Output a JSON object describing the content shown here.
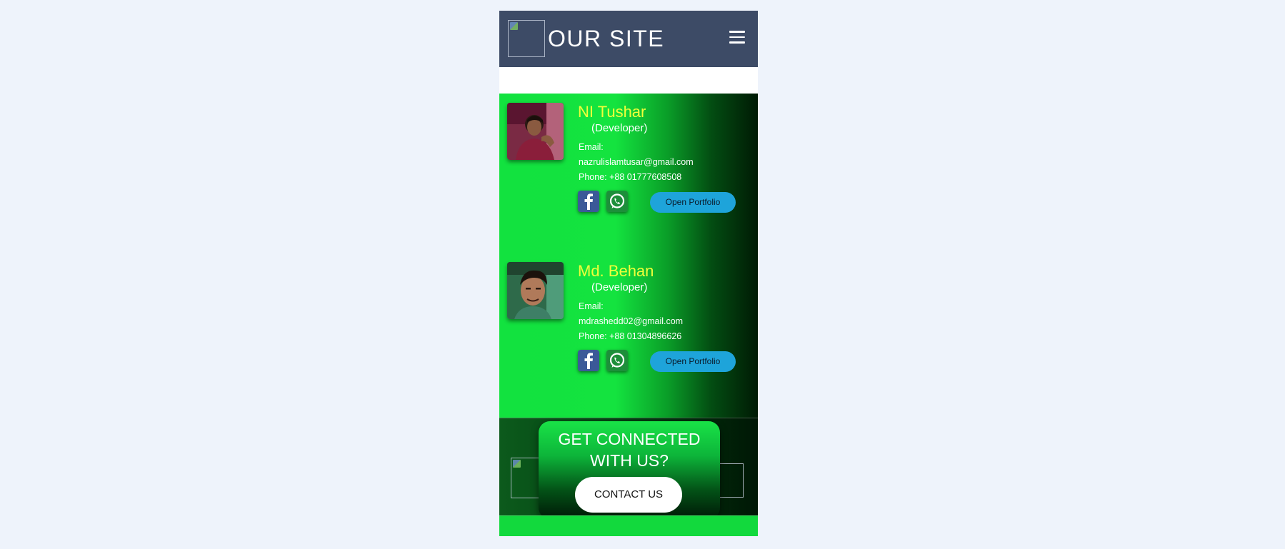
{
  "navbar": {
    "brand": "OUR SITE",
    "logo_icon": "broken-image-icon",
    "menu_icon": "hamburger-menu-icon"
  },
  "team": [
    {
      "name": "NI Tushar",
      "role": "(Developer)",
      "email_label": "Email:",
      "email": "nazrulislamtusar@gmail.com",
      "phone": "Phone: +88 01777608508",
      "portfolio_label": "Open Portfolio"
    },
    {
      "name": "Md. Behan",
      "role": "(Developer)",
      "email_label": "Email:",
      "email": "mdrashedd02@gmail.com",
      "phone": "Phone: +88 01304896626",
      "portfolio_label": "Open Portfolio"
    }
  ],
  "connect": {
    "title": "GET CONNECTED\nWITH US?",
    "button_label": "CONTACT US"
  },
  "colors": {
    "navbar": "#3d4b66",
    "name_yellow": "#f0ff3a",
    "portfolio_button": "#1ea4da",
    "green": "#12e23f"
  }
}
